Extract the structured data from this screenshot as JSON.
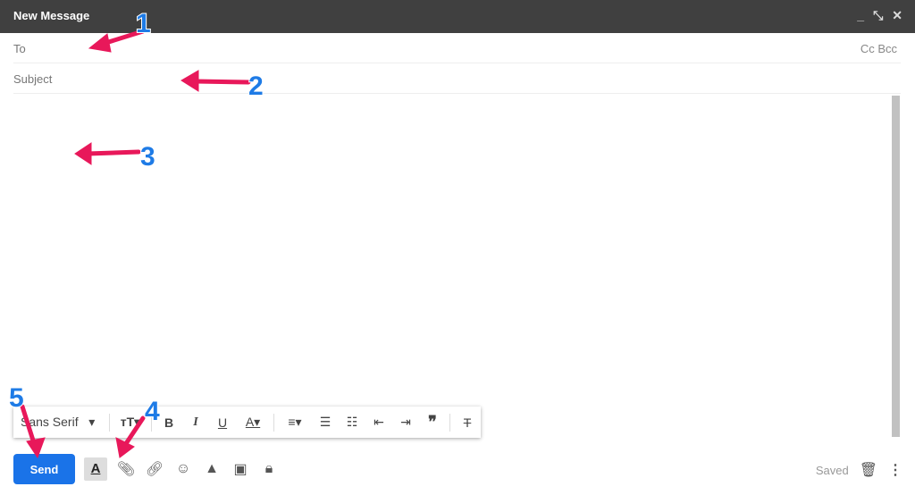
{
  "window": {
    "title": "New Message",
    "minimize": "_",
    "expand": "⤡",
    "close": "✕"
  },
  "to": {
    "label": "To",
    "cc_bcc": "Cc Bcc"
  },
  "subject": {
    "placeholder": "Subject"
  },
  "format_toolbar": {
    "font": "Sans Serif",
    "items": [
      "size",
      "bold",
      "italic",
      "underline",
      "text-color",
      "align",
      "numbered-list",
      "bulleted-list",
      "indent-less",
      "indent-more",
      "quote",
      "remove-formatting"
    ]
  },
  "bottom": {
    "send_label": "Send",
    "status": "Saved"
  },
  "annotations": {
    "labels": [
      "1",
      "2",
      "3",
      "4",
      "5"
    ],
    "arrow_color": "#e8185a",
    "number_color": "#1e7be6"
  },
  "colors": {
    "titlebar": "#404040",
    "send": "#1a73e8"
  }
}
